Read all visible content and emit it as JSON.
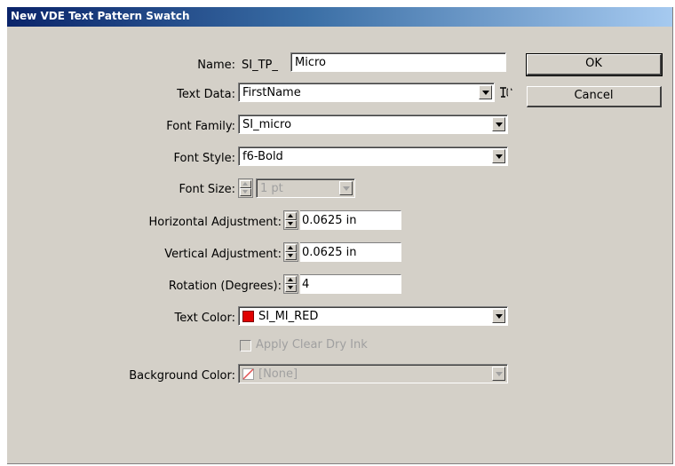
{
  "window": {
    "title": "New VDE Text Pattern Swatch"
  },
  "name": {
    "label": "Name:",
    "prefix": "SI_TP_",
    "value": "Micro"
  },
  "text_data": {
    "label": "Text Data:",
    "value": "FirstName",
    "icon": "text-insert-icon"
  },
  "font_family": {
    "label": "Font Family:",
    "value": "SI_micro"
  },
  "font_style": {
    "label": "Font Style:",
    "value": "f6-Bold"
  },
  "font_size": {
    "label": "Font Size:",
    "value": "1 pt"
  },
  "horizontal_adjustment": {
    "label": "Horizontal Adjustment:",
    "value": "0.0625 in"
  },
  "vertical_adjustment": {
    "label": "Vertical Adjustment:",
    "value": "0.0625 in"
  },
  "rotation": {
    "label": "Rotation (Degrees):",
    "value": "4"
  },
  "text_color": {
    "label": "Text Color:",
    "value": "SI_MI_RED",
    "swatch": "#e00000"
  },
  "apply_clear_dry_ink": {
    "label": "Apply Clear Dry Ink",
    "checked": false
  },
  "background_color": {
    "label": "Background Color:",
    "value": "[None]"
  },
  "buttons": {
    "ok": "OK",
    "cancel": "Cancel"
  }
}
